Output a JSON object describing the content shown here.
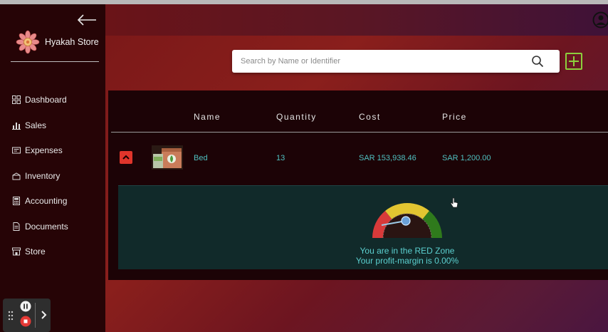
{
  "brand": {
    "name": "Hyakah Store"
  },
  "nav": {
    "items": [
      {
        "label": "Dashboard",
        "icon": "dashboard-grid-icon"
      },
      {
        "label": "Sales",
        "icon": "bar-chart-icon"
      },
      {
        "label": "Expenses",
        "icon": "receipt-icon"
      },
      {
        "label": "Inventory",
        "icon": "box-icon"
      },
      {
        "label": "Accounting",
        "icon": "calculator-icon"
      },
      {
        "label": "Documents",
        "icon": "document-icon"
      },
      {
        "label": "Store",
        "icon": "storefront-icon"
      }
    ]
  },
  "search": {
    "placeholder": "Search by Name or Identifier",
    "value": ""
  },
  "table": {
    "columns": [
      "Name",
      "Quantity",
      "Cost",
      "Price"
    ],
    "rows": [
      {
        "name": "Bed",
        "quantity": "13",
        "cost": "SAR 153,938.46",
        "price": "SAR 1,200.00"
      }
    ]
  },
  "detail": {
    "zone_text": "You are in the RED Zone",
    "margin_text": "Your profit-margin is 0.00%",
    "gauge_value_percent": 0
  },
  "colors": {
    "accent_teal": "#4fc0c0",
    "add_button_green": "#8ccf3c",
    "expand_button_red": "#e0352b",
    "gauge_red": "#d83a3a",
    "gauge_yellow": "#e2c531",
    "gauge_green": "#2f7a1c"
  }
}
